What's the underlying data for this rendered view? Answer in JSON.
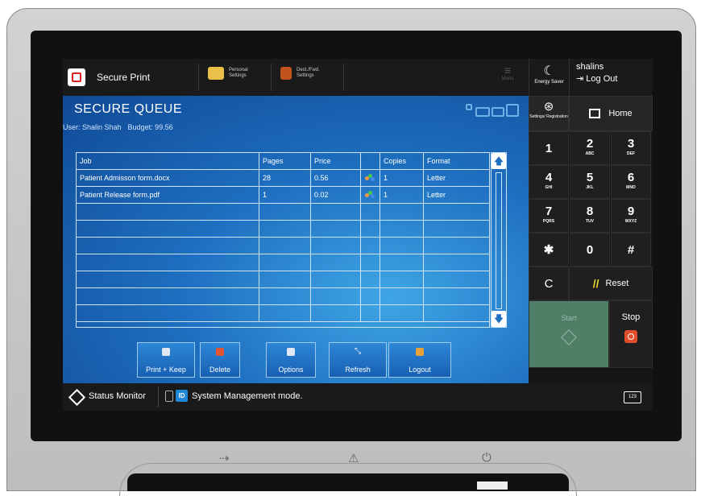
{
  "header": {
    "app_title": "Secure Print",
    "quick_buttons": [
      {
        "line1": "Personal",
        "line2": "Settings",
        "icon": "personal-settings-icon"
      },
      {
        "line1": "Dest./Fwd.",
        "line2": "Settings",
        "icon": "dest-fwd-settings-icon"
      }
    ],
    "menu_label": "Menu",
    "energy_label": "Energy Saver",
    "username": "shalins",
    "logout_label": "Log Out"
  },
  "queue": {
    "title": "SECURE QUEUE",
    "user_label": "User: Shalin Shah",
    "budget_label": "Budget: 99.56",
    "columns": [
      "Job",
      "Pages",
      "Price",
      "",
      "Copies",
      "Format"
    ],
    "rows": [
      {
        "job": "Patient Admisson form.docx",
        "pages": "28",
        "price": "0.56",
        "copies": "1",
        "format": "Letter"
      },
      {
        "job": "Patient Release form.pdf",
        "pages": "1",
        "price": "0.02",
        "copies": "1",
        "format": "Letter"
      }
    ],
    "empty_rows": 7
  },
  "actions": [
    {
      "label": "Print + Keep",
      "icon": "print-keep-icon"
    },
    {
      "label": "Delete",
      "icon": "delete-icon"
    },
    {
      "label": "Options",
      "icon": "options-icon"
    },
    {
      "label": "Refresh",
      "icon": "refresh-icon"
    },
    {
      "label": "Logout",
      "icon": "logout-icon"
    }
  ],
  "keypad": {
    "settings_label": "Settings/ Registration",
    "home_label": "Home",
    "keys": [
      {
        "num": "1",
        "sub": ""
      },
      {
        "num": "2",
        "sub": "ABC"
      },
      {
        "num": "3",
        "sub": "DEF"
      },
      {
        "num": "4",
        "sub": "GHI"
      },
      {
        "num": "5",
        "sub": "JKL"
      },
      {
        "num": "6",
        "sub": "MNO"
      },
      {
        "num": "7",
        "sub": "PQRS"
      },
      {
        "num": "8",
        "sub": "TUV"
      },
      {
        "num": "9",
        "sub": "WXYZ"
      },
      {
        "num": "✱",
        "sub": ""
      },
      {
        "num": "0",
        "sub": ""
      },
      {
        "num": "#",
        "sub": ""
      }
    ],
    "clear_label": "C",
    "reset_label": "Reset",
    "start_label": "Start",
    "stop_label": "Stop"
  },
  "status": {
    "monitor_label": "Status Monitor",
    "id_label": "ID",
    "mode_text": "System Management mode.",
    "keyboard_label": "123"
  },
  "colors": {
    "panel_blue": "#1e6fc0",
    "start_green": "#4f7f67",
    "stop_red": "#e24e2b",
    "reset_yellow": "#e6d52a"
  }
}
